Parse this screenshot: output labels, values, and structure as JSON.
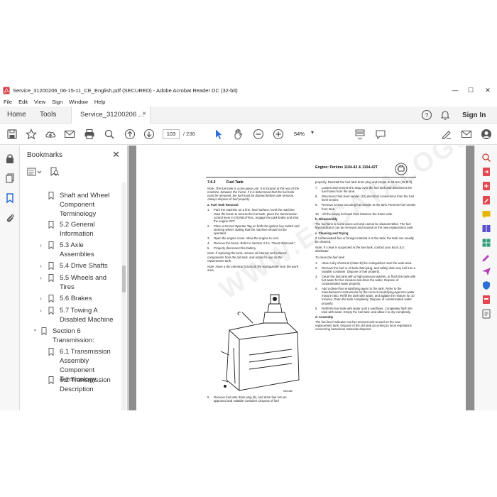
{
  "window": {
    "title": "Service_31200206_06-15-11_CE_English.pdf (SECURED) - Adobe Acrobat Reader DC (32-bit)",
    "controls": {
      "minimize": "—",
      "maximize": "☐",
      "close": "✕"
    }
  },
  "menu": [
    "File",
    "Edit",
    "View",
    "Sign",
    "Window",
    "Help"
  ],
  "tabs": {
    "home": "Home",
    "tools": "Tools",
    "document": "Service_31200206 ...",
    "close": "×",
    "sign_in": "Sign In"
  },
  "toolbar": {
    "page_current": "103",
    "page_total": "/ 236",
    "zoom": "54%",
    "zoom_caret": "▾"
  },
  "bookmarks": {
    "title": "Bookmarks",
    "close": "✕",
    "items": [
      {
        "label": "Shaft and Wheel Component Terminology",
        "level": 2,
        "expandable": false
      },
      {
        "label": "5.2 General Information",
        "level": 2,
        "expandable": false
      },
      {
        "label": "5.3 Axle Assemblies",
        "level": 2,
        "expandable": true
      },
      {
        "label": "5.4 Drive Shafts",
        "level": 2,
        "expandable": true
      },
      {
        "label": "5.5 Wheels and Tires",
        "level": 2,
        "expandable": true
      },
      {
        "label": "5.6 Brakes",
        "level": 2,
        "expandable": true
      },
      {
        "label": "5.7 Towing A Disabled Machine",
        "level": 2,
        "expandable": true
      },
      {
        "label": "Section 6 Transmission:",
        "level": 1,
        "expandable": true
      },
      {
        "label": "6.1 Transmission Assembly Component Terminology",
        "level": 2,
        "expandable": false
      },
      {
        "label": "6.2 Transmission Description",
        "level": 2,
        "expandable": false
      }
    ],
    "chevron_collapsed": "›",
    "chevron_expanded": "⌄"
  },
  "document": {
    "header": "Engine: Perkins 1104-42 & 1104-42T",
    "section_number": "7.6.2",
    "section_title": "Fuel Tank",
    "left_col": {
      "note1": "Note: The fuel tank is a one piece unit. It is located at the rear of the machine, between the frame. If it is determined that the fuel tank must be removed, the fuel must be drained before tank removal. Always dispose of fuel properly.",
      "sub_a": "a. Fuel Tank Removal",
      "steps_a": [
        "Park the machine on a firm, level surface, level the machine, raise the boom to access the fuel tank, place the transmission control lever in (N) NEUTRAL, engage the park brake and shut the engine OFF.",
        "Place a Do Not Operate Tag on both the ignition key switch and steering wheel, stating that the machine should not be operated.",
        "Open the engine cover. Allow the engine to cool.",
        "Remove the boom. Refer to Section 3.3.1, \"Boom Removal.\"",
        "Properly disconnect the battery."
      ],
      "note2": "Note: If replacing the tank, remove all internal and external components from the old tank, and retain for use on the replacement tank.",
      "note3": "Note: Have a dry chemical (Class B) fire extinguisher near the work area.",
      "fig_label": "MZ0486",
      "steps_a2": [
        "Remove fuel tank drain plug (9), and drain fuel into an approved and suitable container. Dispose of fuel"
      ]
    },
    "right_col": {
      "cont": "properly. Reinstall the fuel tank drain plug and torque to 26 Nm (19 lb-ft).",
      "steps": [
        "Loosen and remove the strap over the fuel tank and disconnect the fuel hoses from the tank.",
        "Disconnect fuel level sender (10) electrical connections from the fuel level sender.",
        "Remove screws securing fuel sender to the tank. Remove fuel sender from tank.",
        "Lift the empty fuel tank from between the frame rails."
      ],
      "sub_b": "b. Disassembly",
      "text_b": "The fuel tank is a one-piece unit and cannot be disassembled. The fuel level indicator can be removed and reused on the new replacement tank.",
      "sub_c": "c. Cleaning and Drying",
      "text_c": "If contaminated fuel or foreign material is in the tank, the tank can usually be cleaned.",
      "note_c": "Note: If a leak is suspected in the fuel tank, contact your local JLG distributor.",
      "to_clean": "To clean the fuel tank:",
      "steps_c": [
        "Have a dry chemical (Class B) fire extinguisher near the work area.",
        "Remove the fuel or oil tank drain plug, and safely drain any fuel into a suitable container. Dispose of fuel properly.",
        "Clean the fuel tank with a high-pressure washer, or flush the tank with hot water for five minutes and drain the water. Dispose of contaminated water properly.",
        "Add a diesel fuel emulsifying agent to the tank. Refer to the manufacturer's instructions for the correct emulsifying-agent-to-water mixture ratio. Refill the tank with water, and agitate the mixture for 10 minutes. Drain the tank completely. Dispose of contaminated water properly.",
        "Refill the fuel tank with water until it overflows. Completely flush the tank with water. Empty the fuel tank, and allow it to dry completely."
      ],
      "sub_d": "d. Assembly",
      "text_d": "The fuel level indicator can be removed and reused on the new replacement tank. Dispose of the old tank according to local regulations concerning hazardous materials disposal."
    },
    "watermark": "WWW.EPCATALOGS.COM"
  },
  "colors": {
    "acrobat_red": "#d7373f",
    "doc_bg": "#8e8e8e",
    "pointer_blue": "#2b6fd6"
  }
}
